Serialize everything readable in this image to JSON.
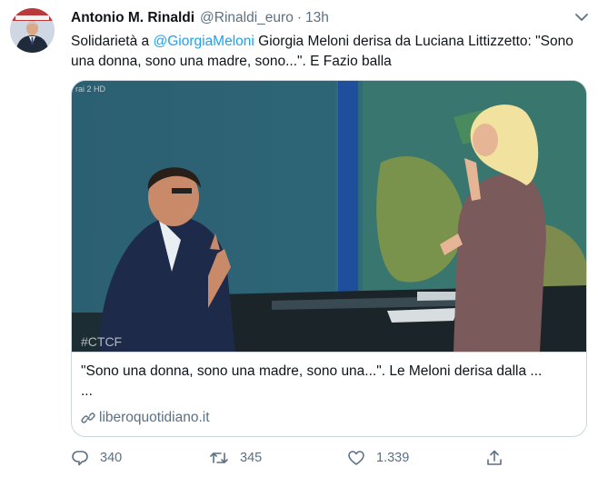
{
  "tweet": {
    "author_name": "Antonio M. Rinaldi",
    "handle": "@Rinaldi_euro",
    "separator": "·",
    "time": "13h",
    "text_before": "Solidarietà a ",
    "mention": "@GiorgiaMeloni",
    "text_after": " Giorgia Meloni derisa da Luciana Littizzetto: \"Sono una donna, sono una madre, sono...\". E Fazio balla"
  },
  "card": {
    "video_channel_logo": "rai 2 HD",
    "video_hashtag": "#CTCF",
    "title": "\"Sono una donna, sono una madre, sono una...\". Le Meloni derisa dalla ...",
    "ellipsis": "...",
    "domain": "liberoquotidiano.it"
  },
  "actions": {
    "reply_count": "340",
    "retweet_count": "345",
    "like_count": "1.339"
  },
  "icons": [
    "avatar",
    "chevron-down-icon",
    "link-icon",
    "reply-icon",
    "retweet-icon",
    "like-icon",
    "share-icon"
  ],
  "colors": {
    "mention": "#1da1f2",
    "secondary_text": "#5b7083",
    "border": "#ccd6dd"
  }
}
